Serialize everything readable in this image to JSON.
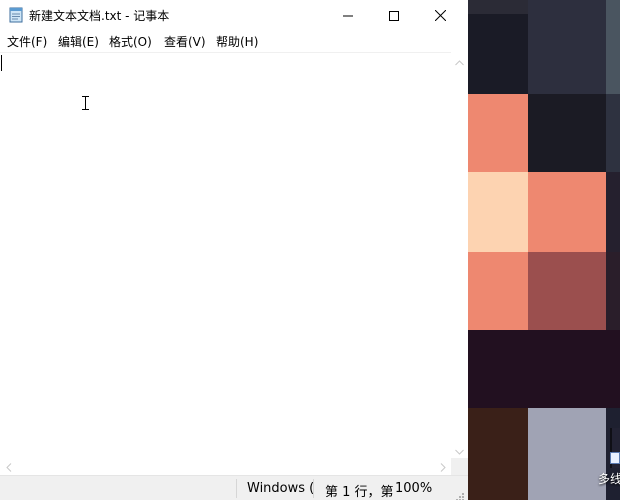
{
  "window": {
    "title": "新建文本文档.txt - 记事本",
    "app_icon": "notepad-icon",
    "controls": {
      "minimize_icon": "minimize-icon",
      "maximize_icon": "maximize-icon",
      "close_icon": "close-icon"
    }
  },
  "menu": {
    "items": [
      {
        "label": "文件(F)"
      },
      {
        "label": "编辑(E)"
      },
      {
        "label": "格式(O)"
      },
      {
        "label": "查看(V)"
      },
      {
        "label": "帮助(H)"
      }
    ]
  },
  "editor": {
    "content": ""
  },
  "status": {
    "encoding": "Windows (",
    "position": "第 1 行，第",
    "zoom": "100%"
  },
  "desktop": {
    "shortcut_label": "多线"
  },
  "colors": {
    "salmon": "#ee8870",
    "peach": "#fdd3b1",
    "maroon": "#9b4f4e",
    "dark_navy": "#1a1b26",
    "dark_purple": "#221020",
    "brown": "#3a2018",
    "grey_blue": "#a0a3b4"
  }
}
